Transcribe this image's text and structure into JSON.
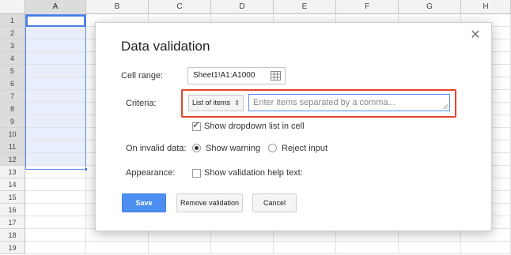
{
  "sheet": {
    "columns": [
      "A",
      "B",
      "C",
      "D",
      "E",
      "F",
      "G",
      "H"
    ],
    "rows": [
      "1",
      "2",
      "3",
      "4",
      "5",
      "6",
      "7",
      "8",
      "9",
      "10",
      "11",
      "12",
      "13",
      "14",
      "15",
      "16",
      "17",
      "18",
      "19"
    ]
  },
  "dialog": {
    "title": "Data validation",
    "cell_range": {
      "label": "Cell range:",
      "value": "Sheet1!A1:A1000"
    },
    "criteria": {
      "label": "Criteria:",
      "type_value": "List of items",
      "input_placeholder": "Enter items separated by a comma...",
      "input_value": ""
    },
    "show_dropdown": {
      "label": "Show dropdown list in cell",
      "checked": true
    },
    "on_invalid": {
      "label": "On invalid data:",
      "options": [
        {
          "label": "Show warning",
          "selected": true
        },
        {
          "label": "Reject input",
          "selected": false
        }
      ]
    },
    "appearance": {
      "label": "Appearance:",
      "help_text_label": "Show validation help text:",
      "checked": false
    },
    "buttons": {
      "save": "Save",
      "remove": "Remove validation",
      "cancel": "Cancel"
    },
    "icons": {
      "close": "close-icon",
      "range": "grid-icon"
    }
  },
  "colors": {
    "accent": "#4d8ff0",
    "highlight": "#e3462e",
    "selection": "#e8eefb"
  }
}
